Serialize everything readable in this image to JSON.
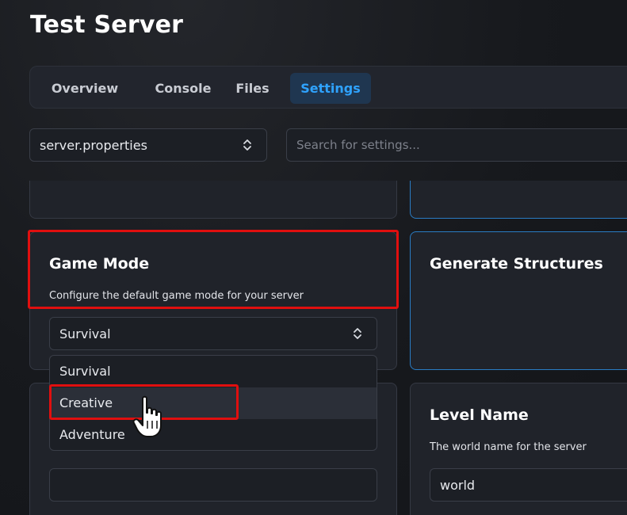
{
  "page": {
    "title": "Test Server"
  },
  "tabs": [
    {
      "label": "Overview",
      "active": false
    },
    {
      "label": "Console",
      "active": false
    },
    {
      "label": "Files",
      "active": false
    },
    {
      "label": "Settings",
      "active": true
    }
  ],
  "file_select": {
    "value": "server.properties",
    "icon": "chevron-updown-icon"
  },
  "search": {
    "placeholder": "Search for settings..."
  },
  "settings": {
    "game_mode": {
      "title": "Game Mode",
      "description": "Configure the default game mode for your server",
      "value": "Survival",
      "options": [
        "Survival",
        "Creative",
        "Adventure"
      ],
      "hovered_option": "Creative"
    },
    "generate_structures": {
      "title": "Generate Structures"
    },
    "level_name": {
      "title": "Level Name",
      "description": "The world name for the server",
      "value": "world"
    }
  },
  "colors": {
    "accent": "#2fa3ff",
    "highlight_border": "#e00f0f",
    "active_card_border": "#2a7cc4",
    "background": "#15171c",
    "card": "#20232a"
  },
  "icons": [
    "chevron-updown-icon",
    "hand-pointer-icon"
  ]
}
